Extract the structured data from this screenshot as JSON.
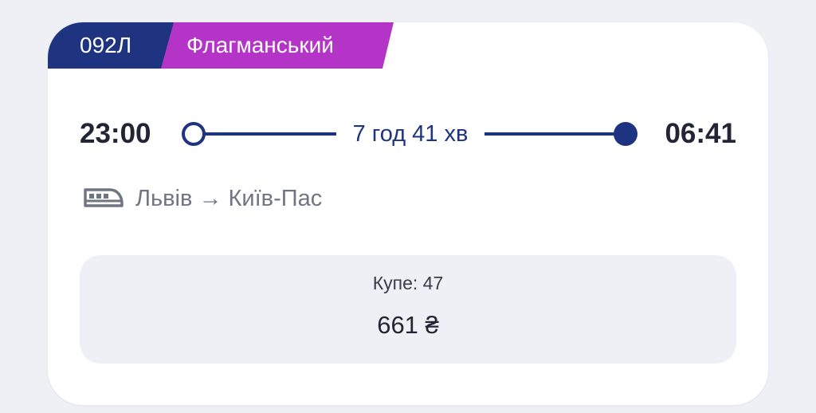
{
  "train": {
    "number": "092Л",
    "type": "Флагманський"
  },
  "schedule": {
    "departure": "23:00",
    "arrival": "06:41",
    "duration": "7 год 41 хв"
  },
  "route": {
    "text": "Львів → Київ-Пас",
    "icon": "train-icon"
  },
  "fare": {
    "class_seats": "Купе: 47",
    "price": "661 ₴"
  },
  "colors": {
    "navy": "#1f3480",
    "purple": "#b434c8",
    "background": "#eef0f5"
  }
}
